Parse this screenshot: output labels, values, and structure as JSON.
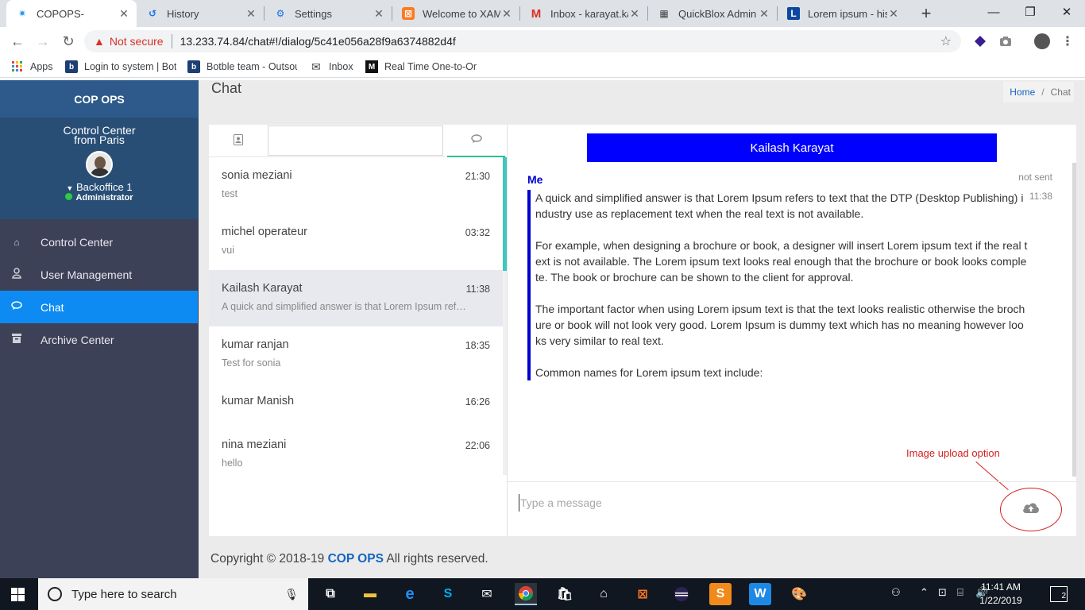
{
  "browser": {
    "tabs": [
      {
        "title": "COPOPS-",
        "icon": "copops-favicon",
        "color": "#2196f3"
      },
      {
        "title": "History",
        "icon": "history-icon",
        "color": "#1a73e8"
      },
      {
        "title": "Settings",
        "icon": "gear-icon",
        "color": "#1a73e8"
      },
      {
        "title": "Welcome to XAMPP",
        "icon": "xampp-icon",
        "color": "#fb7a24"
      },
      {
        "title": "Inbox - karayat.ka",
        "icon": "gmail-icon",
        "color": "#d93025"
      },
      {
        "title": "QuickBlox Admin P",
        "icon": "grid-icon",
        "color": "#444444"
      },
      {
        "title": "Lorem ipsum - hist",
        "icon": "letter-l-icon",
        "color": "#0d47a1"
      }
    ],
    "address": {
      "security_label": "Not secure",
      "url": "13.233.74.84/chat#!/dialog/5c41e056a28f9a6374882d4f"
    },
    "bookmarks": [
      {
        "label": "Apps",
        "icon": "apps-grid-icon"
      },
      {
        "label": "Login to system | Bot",
        "icon": "botble-icon"
      },
      {
        "label": "Botble team - Outsou",
        "icon": "botble-icon"
      },
      {
        "label": "Inbox",
        "icon": "mail-icon"
      },
      {
        "label": "Real Time One-to-On",
        "icon": "medium-icon"
      }
    ]
  },
  "sidebar": {
    "brand": "COP OPS",
    "org_line1": "Control Center",
    "org_line2": "from Paris",
    "user_name": "Backoffice 1",
    "user_role": "Administrator",
    "items": [
      {
        "label": "Control Center",
        "icon": "home-icon",
        "active": false
      },
      {
        "label": "User Management",
        "icon": "user-icon",
        "active": false
      },
      {
        "label": "Chat",
        "icon": "chat-icon",
        "active": true
      },
      {
        "label": "Archive Center",
        "icon": "archive-icon",
        "active": false
      }
    ]
  },
  "page": {
    "title": "Chat",
    "breadcrumb_home": "Home",
    "breadcrumb_sep": "/",
    "breadcrumb_current": "Chat"
  },
  "dialogs": [
    {
      "name": "sonia meziani",
      "time": "21:30",
      "last": "test",
      "active": false
    },
    {
      "name": "michel operateur",
      "time": "03:32",
      "last": "vui",
      "active": false
    },
    {
      "name": "Kailash Karayat",
      "time": "11:38",
      "last": "A quick and simplified answer is that Lorem Ipsum refers to text that the DTP",
      "active": true
    },
    {
      "name": "kumar ranjan",
      "time": "18:35",
      "last": "Test for sonia",
      "active": false
    },
    {
      "name": "kumar Manish",
      "time": "16:26",
      "last": "",
      "active": false
    },
    {
      "name": "nina meziani",
      "time": "22:06",
      "last": "hello",
      "active": false
    }
  ],
  "chat": {
    "header_name": "Kailash Karayat",
    "message": {
      "author": "Me",
      "status": "not sent",
      "time": "11:38",
      "paragraphs": [
        "A quick and simplified answer is that Lorem Ipsum refers to text that the DTP (Desktop Publishing) industry use as replacement text when the real text is not available.",
        "For example, when designing a brochure or book, a designer will insert Lorem ipsum text if the real text is not available. The Lorem ipsum text looks real enough that the brochure or book looks complete. The book or brochure can be shown to the client for approval.",
        "The important factor when using Lorem ipsum text is that the text looks realistic otherwise the brochure or book will not look very good. Lorem Ipsum is dummy text which has no meaning however looks very similar to real text.",
        "Common names for Lorem ipsum text include:"
      ]
    },
    "input_placeholder": "Type a message",
    "annotation": "Image upload option"
  },
  "footer": {
    "prefix": "Copyright © 2018-19 ",
    "brand": "COP OPS",
    "suffix": " All rights reserved."
  },
  "taskbar": {
    "search_placeholder": "Type here to search",
    "time": "11:41 AM",
    "date": "1/22/2019",
    "notification_count": "2"
  },
  "colors": {
    "sidebar_bg": "#3d4158",
    "brand_bg": "#2d5a8a",
    "active_nav": "#0d8bf2",
    "chat_header": "#0000ff",
    "annotation": "#d42020"
  }
}
